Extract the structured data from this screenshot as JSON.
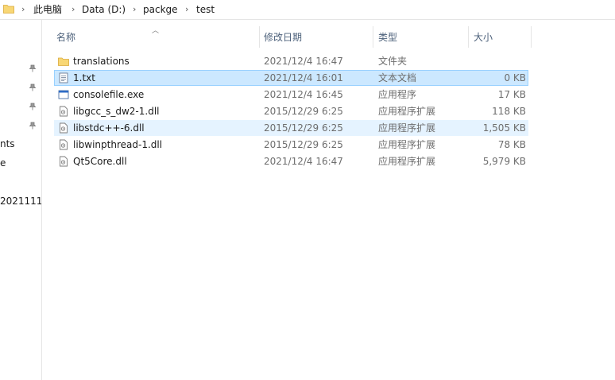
{
  "address": {
    "crumbs": [
      "此电脑",
      "Data (D:)",
      "packge",
      "test"
    ]
  },
  "nav": {
    "items": [
      "nts",
      "e",
      "2021111"
    ]
  },
  "columns": {
    "name": "名称",
    "date": "修改日期",
    "type": "类型",
    "size": "大小"
  },
  "files": [
    {
      "name": "translations",
      "date": "2021/12/4 16:47",
      "type": "文件夹",
      "size": "",
      "icon": "folder-icon",
      "state": "normal"
    },
    {
      "name": "1.txt",
      "date": "2021/12/4 16:01",
      "type": "文本文档",
      "size": "0 KB",
      "icon": "text-file-icon",
      "state": "selected"
    },
    {
      "name": "consolefile.exe",
      "date": "2021/12/4 16:45",
      "type": "应用程序",
      "size": "17 KB",
      "icon": "exe-icon",
      "state": "normal"
    },
    {
      "name": "libgcc_s_dw2-1.dll",
      "date": "2015/12/29 6:25",
      "type": "应用程序扩展",
      "size": "118 KB",
      "icon": "dll-icon",
      "state": "normal"
    },
    {
      "name": "libstdc++-6.dll",
      "date": "2015/12/29 6:25",
      "type": "应用程序扩展",
      "size": "1,505 KB",
      "icon": "dll-icon",
      "state": "hover"
    },
    {
      "name": "libwinpthread-1.dll",
      "date": "2015/12/29 6:25",
      "type": "应用程序扩展",
      "size": "78 KB",
      "icon": "dll-icon",
      "state": "normal"
    },
    {
      "name": "Qt5Core.dll",
      "date": "2021/12/4 16:47",
      "type": "应用程序扩展",
      "size": "5,979 KB",
      "icon": "dll-icon",
      "state": "normal"
    }
  ],
  "colors": {
    "selected_bg": "#cce8ff",
    "hover_bg": "#e5f3ff",
    "header_text": "#4c607a",
    "folder": "#f8d775"
  }
}
